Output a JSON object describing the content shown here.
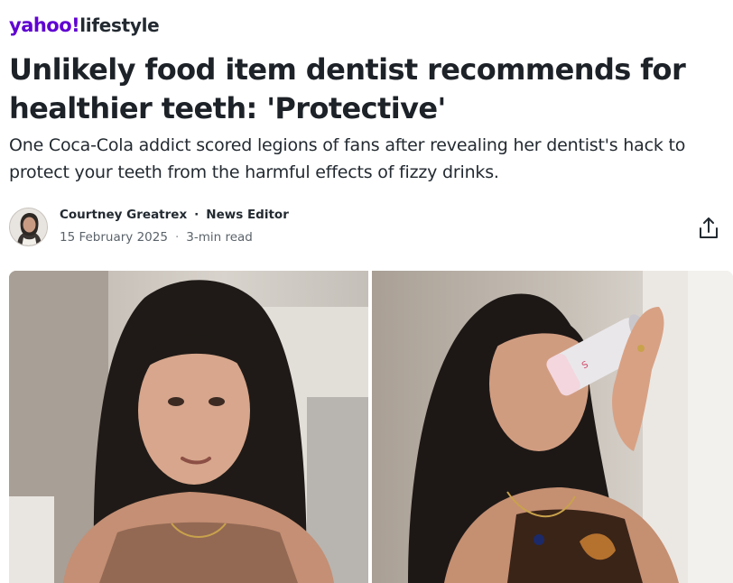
{
  "brand": {
    "logo": "yahoo!",
    "section": "lifestyle",
    "accent_color": "#6001d2"
  },
  "article": {
    "headline": "Unlikely food item dentist recommends for healthier teeth: 'Protective'",
    "summary": "One Coca-Cola addict scored legions of fans after revealing her dentist's hack to protect your teeth from the harmful effects of fizzy drinks."
  },
  "author": {
    "name": "Courtney Greatrex",
    "separator": "·",
    "role": "News Editor",
    "date": "15 February 2025",
    "read_time": "3-min read"
  },
  "actions": {
    "share_icon": "share-icon"
  },
  "images": {
    "left": "woman-talking-to-camera",
    "right": "woman-drinking-soda-can"
  }
}
